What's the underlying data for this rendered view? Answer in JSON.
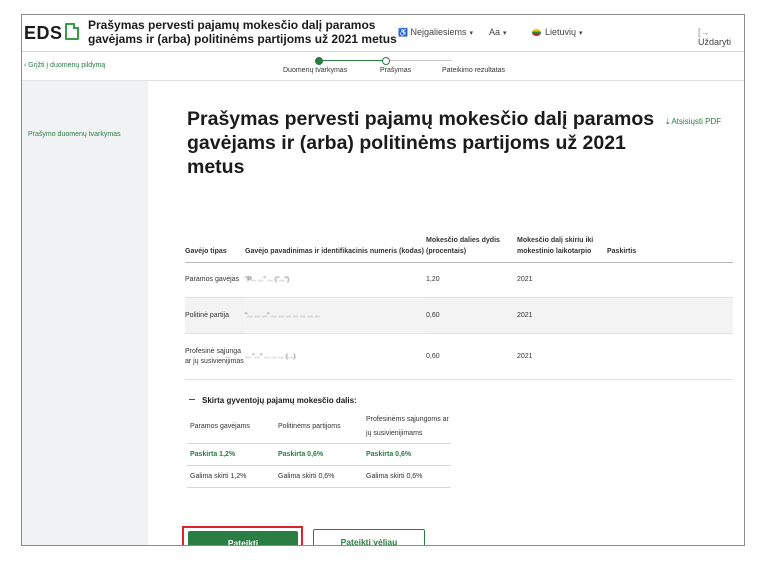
{
  "header": {
    "logo": "EDS",
    "title": "Prašymas pervesti pajamų mokesčio dalį paramos gavėjams ir (arba) politinėms partijoms už 2021 metus",
    "accessibility": "Neįgaliesiems",
    "font_size": "Aa",
    "language": "Lietuvių",
    "close": "Uždaryti",
    "icons": {
      "accessibility": "accessibility-icon",
      "close": "exit-icon",
      "flag": "lithuania-flag-icon"
    }
  },
  "progress": {
    "back_link": "Grįžti į duomenų pildymą",
    "steps": [
      {
        "label": "Duomenų tvarkymas"
      },
      {
        "label": "Prašymas"
      },
      {
        "label": "Pateikimo rezultatas"
      }
    ]
  },
  "sidebar": {
    "link": "Prašymo duomenų tvarkymas"
  },
  "main": {
    "title": "Prašymas pervesti pajamų mokesčio dalį paramos gavėjams ir (arba) politinėms partijoms už 2021 metus",
    "download_pdf": "Atsisiųsti PDF",
    "table": {
      "headers": [
        "Gavėjo tipas",
        "Gavėjo pavadinimas ir identifikacinis numeris (kodas)",
        "Mokesčio dalies dydis (procentais)",
        "Mokesčio dalį skiriu iki mokestinio laikotarpio",
        "Paskirtis"
      ],
      "rows": [
        {
          "type": "Paramos gavėjas",
          "name": "\"P... ...\"   ... (\"...\")",
          "pct": "1,20",
          "year": "2021",
          "purpose": ""
        },
        {
          "type": "Politinė partija",
          "name": "\"... ... ...\" ... ... ... ... ... ... ...",
          "pct": "0,60",
          "year": "2021",
          "purpose": ""
        },
        {
          "type": "Profesinė sąjunga ar jų susivienijimas",
          "name": "... \"...\" ... ... ... (...)",
          "pct": "0,60",
          "year": "2021",
          "purpose": ""
        }
      ]
    },
    "summary": {
      "title": "Skirta gyventojų pajamų mokesčio dalis:",
      "headers": [
        "Paramos gavėjams",
        "Politinėms partijoms",
        "Profesinėms sąjungoms ar jų susivienijimams"
      ],
      "allocated": [
        "Paskirta 1,2%",
        "Paskirta 0,6%",
        "Paskirta 0,6%"
      ],
      "available": [
        "Galima skirti 1,2%",
        "Galima skirti 0,6%",
        "Galima skirti 0,6%"
      ]
    },
    "buttons": {
      "submit": "Pateikti",
      "submit_later": "Pateikti vėliau"
    }
  },
  "colors": {
    "accent": "#2a7d43",
    "highlight": "#d9242b",
    "sidebar_bg": "#f1f2f4"
  }
}
